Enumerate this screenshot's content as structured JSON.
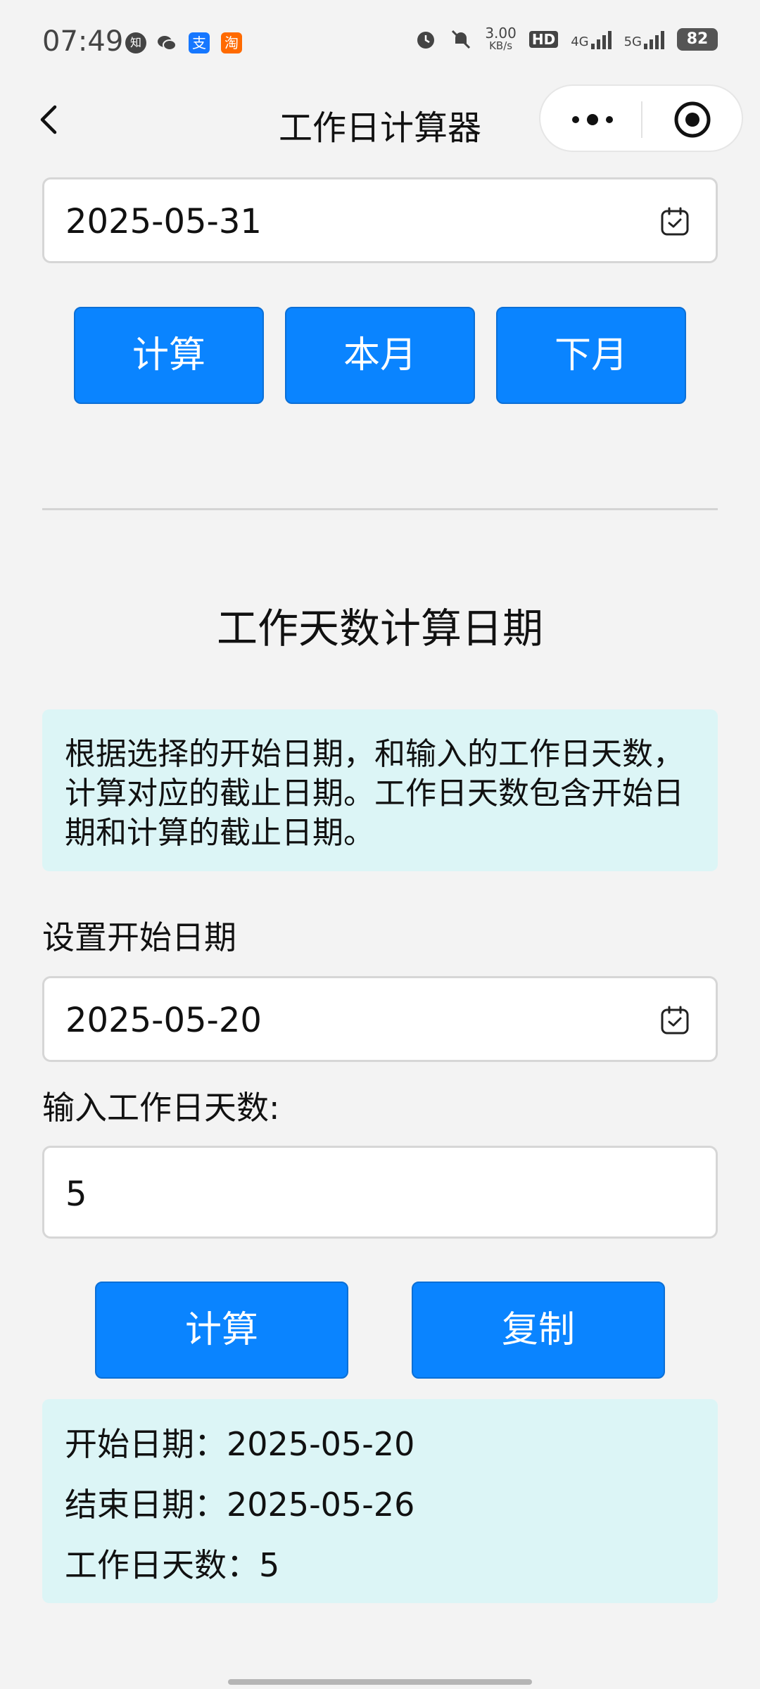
{
  "status_bar": {
    "time": "07:49",
    "app_icons": [
      {
        "icon": "zhihu-icon",
        "label": "知",
        "color": "#444444"
      },
      {
        "icon": "wechat-icon",
        "label": "",
        "color": "#444444"
      },
      {
        "icon": "alipay-icon",
        "label": "支",
        "color": "#1677ff"
      },
      {
        "icon": "taobao-icon",
        "label": "淘",
        "color": "#ff6a00"
      }
    ],
    "net_speed_value": "3.00",
    "net_speed_unit": "KB/s",
    "hd_label": "HD",
    "network_4g": "4G",
    "network_5g": "5G",
    "battery": "82"
  },
  "nav": {
    "title": "工作日计算器"
  },
  "top_section": {
    "end_date_value": "2025-05-31",
    "buttons": {
      "calculate": "计算",
      "this_month": "本月",
      "next_month": "下月"
    }
  },
  "workday_section": {
    "title": "工作天数计算日期",
    "description": "根据选择的开始日期，和输入的工作日天数，计算对应的截止日期。工作日天数包含开始日期和计算的截止日期。",
    "start_date_label": "设置开始日期",
    "start_date_value": "2025-05-20",
    "days_label": "输入工作日天数:",
    "days_value": "5",
    "buttons": {
      "calculate": "计算",
      "copy": "复制"
    },
    "result": {
      "start": "开始日期：2025-05-20",
      "end": "结束日期：2025-05-26",
      "days": "工作日天数：5"
    }
  },
  "colors": {
    "accent": "#0a84ff",
    "info_bg": "#dcf5f6",
    "page_bg": "#f3f3f3"
  }
}
